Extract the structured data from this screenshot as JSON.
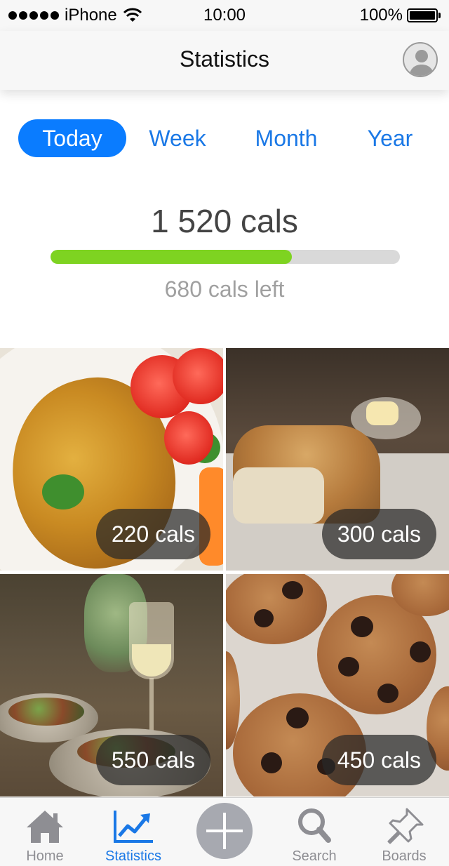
{
  "status_bar": {
    "carrier": "iPhone",
    "time": "10:00",
    "battery_percent": "100%",
    "icons": [
      "signal-dots-icon",
      "wifi-icon",
      "battery-icon"
    ]
  },
  "nav": {
    "title": "Statistics",
    "avatar_icon": "user-avatar-icon"
  },
  "period_tabs": {
    "selected": "Today",
    "items": [
      {
        "label": "Today"
      },
      {
        "label": "Week"
      },
      {
        "label": "Month"
      },
      {
        "label": "Year"
      }
    ]
  },
  "summary": {
    "total": "1 520 cals",
    "left": "680 cals left",
    "progress_fraction": 0.69,
    "progress_color": "#7ed321",
    "track_color": "#d9d9d9"
  },
  "meals": [
    {
      "cals": "220 cals",
      "photo": "omelette-with-tomatoes"
    },
    {
      "cals": "300 cals",
      "photo": "bread-loaf"
    },
    {
      "cals": "550 cals",
      "photo": "dinner-table-wine"
    },
    {
      "cals": "450 cals",
      "photo": "chocolate-chip-cookies"
    }
  ],
  "tab_bar": {
    "selected": "Statistics",
    "items": [
      {
        "label": "Home",
        "icon": "home-icon"
      },
      {
        "label": "Statistics",
        "icon": "chart-icon"
      },
      {
        "label": "",
        "icon": "add-icon"
      },
      {
        "label": "Search",
        "icon": "search-icon"
      },
      {
        "label": "Boards",
        "icon": "pin-icon"
      }
    ],
    "accent": "#1a78e6",
    "inactive": "#8e8e93"
  }
}
